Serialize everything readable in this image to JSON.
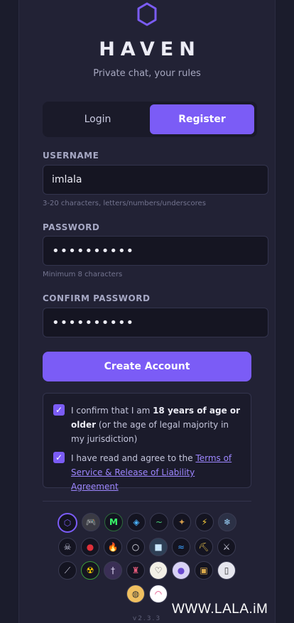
{
  "brand": {
    "name": "HAVEN",
    "tagline": "Private chat, your rules"
  },
  "tabs": [
    {
      "label": "Login",
      "active": false
    },
    {
      "label": "Register",
      "active": true
    }
  ],
  "form": {
    "username": {
      "label": "USERNAME",
      "value": "imlala",
      "hint": "3-20 characters, letters/numbers/underscores"
    },
    "password": {
      "label": "PASSWORD",
      "value": "••••••••••",
      "hint": "Minimum 8 characters"
    },
    "confirm": {
      "label": "CONFIRM PASSWORD",
      "value": "••••••••••"
    },
    "submit": "Create Account"
  },
  "consent": {
    "age": {
      "pre": "I confirm that I am ",
      "bold": "18 years of age or older",
      "post": " (or the age of legal majority in my jurisdiction)",
      "checked": true
    },
    "terms": {
      "pre": "I have read and agree to the ",
      "link": "Terms of Service & Release of Liability Agreement",
      "checked": true
    }
  },
  "icon_picker": {
    "rows": [
      [
        "hexagon-icon",
        "gamepad-icon",
        "m-letter-icon",
        "diamond-icon",
        "tilde-icon",
        "ornament-icon",
        "lightning-icon",
        "snowflake-icon"
      ],
      [
        "skull-icon",
        "blood-drop-icon",
        "flame-icon",
        "ring-icon",
        "ice-cube-icon",
        "wave-icon",
        "pickaxe-icon",
        "crossed-swords-icon"
      ],
      [
        "wand-icon",
        "radioactive-icon",
        "dagger-icon",
        "castle-icon",
        "dove-icon",
        "crystal-ball-icon",
        "tv-icon",
        "phone-icon"
      ],
      [
        "palette-icon",
        "rainbow-icon"
      ]
    ],
    "selected": "hexagon-icon"
  },
  "version": "v2.3.3",
  "watermark": "WWW.LALA.iM",
  "colors": {
    "accent": "#7b5cf6",
    "background": "#1b1c2c",
    "card": "#222235"
  }
}
